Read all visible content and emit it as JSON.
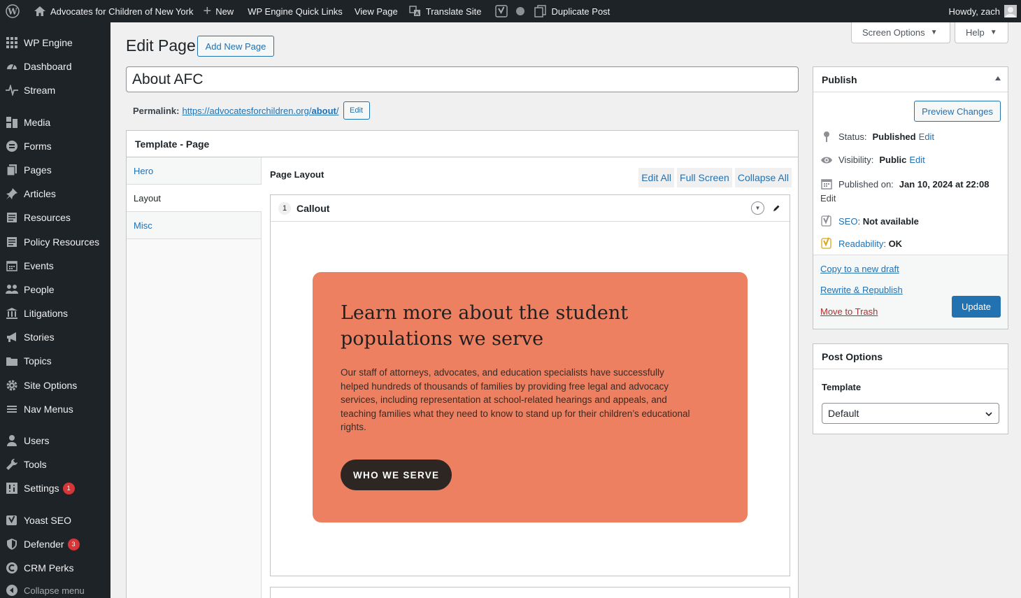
{
  "adminbar": {
    "site_name": "Advocates for Children of New York",
    "new_label": "New",
    "quick_links": "WP Engine Quick Links",
    "view_page": "View Page",
    "translate": "Translate Site",
    "duplicate": "Duplicate Post",
    "howdy": "Howdy, zach"
  },
  "sidebar": {
    "items": [
      {
        "label": "WP Engine",
        "icon": "grid-icon"
      },
      {
        "label": "Dashboard",
        "icon": "dashboard-icon"
      },
      {
        "label": "Stream",
        "icon": "pulse-icon"
      },
      {
        "label": "Media",
        "icon": "media-icon"
      },
      {
        "label": "Forms",
        "icon": "forms-icon"
      },
      {
        "label": "Pages",
        "icon": "pages-icon"
      },
      {
        "label": "Articles",
        "icon": "pin-icon"
      },
      {
        "label": "Resources",
        "icon": "document-icon"
      },
      {
        "label": "Policy Resources",
        "icon": "document-icon"
      },
      {
        "label": "Events",
        "icon": "calendar-icon"
      },
      {
        "label": "People",
        "icon": "people-icon"
      },
      {
        "label": "Litigations",
        "icon": "bank-icon"
      },
      {
        "label": "Stories",
        "icon": "megaphone-icon"
      },
      {
        "label": "Topics",
        "icon": "folder-icon"
      },
      {
        "label": "Site Options",
        "icon": "gear-icon"
      },
      {
        "label": "Nav Menus",
        "icon": "menu-icon"
      },
      {
        "label": "Users",
        "icon": "user-icon"
      },
      {
        "label": "Tools",
        "icon": "wrench-icon"
      },
      {
        "label": "Settings",
        "icon": "settings-icon",
        "badge": "1"
      },
      {
        "label": "Yoast SEO",
        "icon": "yoast-icon"
      },
      {
        "label": "Defender",
        "icon": "shield-icon",
        "badge": "3"
      },
      {
        "label": "CRM Perks",
        "icon": "crm-icon"
      }
    ],
    "collapse": "Collapse menu"
  },
  "screen_options": "Screen Options",
  "help": "Help",
  "page": {
    "heading": "Edit Page",
    "add_new": "Add New Page",
    "title_value": "About AFC",
    "permalink_label": "Permalink:",
    "permalink_base": "https://advocatesforchildren.org/",
    "permalink_slug": "about",
    "permalink_end": "/",
    "permalink_edit": "Edit"
  },
  "template_box": {
    "title": "Template - Page",
    "tabs": [
      "Hero",
      "Layout",
      "Misc"
    ],
    "active_tab": "Layout",
    "page_layout_label": "Page Layout",
    "actions": [
      "Edit All",
      "Full Screen",
      "Collapse All"
    ],
    "block": {
      "order": "1",
      "title": "Callout",
      "heading": "Learn more about the student populations we serve",
      "body": "Our staff of attorneys, advocates, and education specialists have successfully helped hundreds of thousands of families by providing free legal and advocacy services, including representation at school-related hearings and appeals, and teaching families what they need to know to stand up for their children’s educational rights.",
      "cta": "WHO WE SERVE",
      "card_color": "#ed8061"
    }
  },
  "publish": {
    "title": "Publish",
    "preview": "Preview Changes",
    "status_label": "Status:",
    "status_value": "Published",
    "visibility_label": "Visibility:",
    "visibility_value": "Public",
    "published_label": "Published on:",
    "published_value": "Jan 10, 2024 at 22:08",
    "edit": "Edit",
    "seo_label": "SEO",
    "seo_value": "Not available",
    "readability_label": "Readability",
    "readability_value": "OK",
    "copy_draft": "Copy to a new draft",
    "rewrite": "Rewrite & Republish",
    "trash": "Move to Trash",
    "update": "Update"
  },
  "post_options": {
    "title": "Post Options",
    "template_label": "Template",
    "template_value": "Default"
  },
  "colors": {
    "admin_dark": "#1d2327",
    "link_blue": "#2271b1",
    "badge_red": "#d63638",
    "callout_orange": "#ed8061"
  }
}
